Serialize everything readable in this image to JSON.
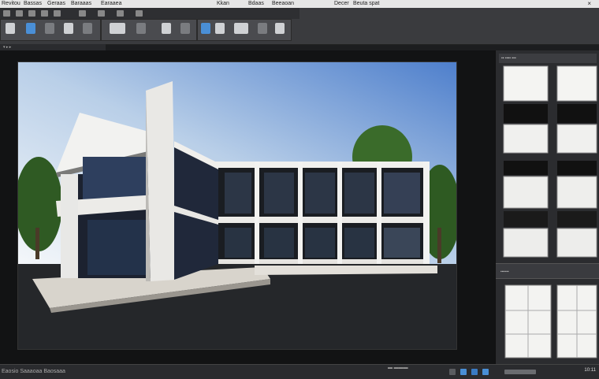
{
  "menubar": {
    "items": [
      "Revitou",
      "Bassas",
      "Geraas",
      "Baraaas",
      "Earaaea",
      "Kkan",
      "Bdaas",
      "Beeaoan",
      "Decer",
      "Beuta spat"
    ],
    "close": "×"
  },
  "subbar": {
    "label": "▾ ▸ ▸"
  },
  "right_panel": {
    "header": "▪▪ ▪▪▪▪ ▪▪▪",
    "section": "▪▪▪▪▪▪"
  },
  "statusbar": {
    "left_text": "Eaosio Saaaoaa Baosaaa",
    "mid_text": "▬ ▬▬▬",
    "time": "10:11"
  },
  "colors": {
    "sky_top": "#5b86c9",
    "sky_bottom": "#dfe8f2",
    "ground": "#25272a",
    "accent": "#4a8fd6"
  }
}
